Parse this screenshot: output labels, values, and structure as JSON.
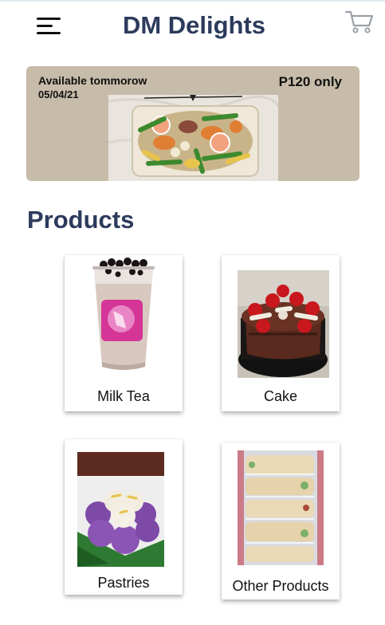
{
  "header": {
    "title": "DM Delights",
    "menu_icon": "hamburger-menu-icon",
    "cart_icon": "shopping-cart-icon"
  },
  "banner": {
    "availability": "Available tommorow",
    "date": "05/04/21",
    "price": "P120 only"
  },
  "products_section": {
    "title": "Products",
    "items": [
      {
        "label": "Milk Tea"
      },
      {
        "label": "Cake"
      },
      {
        "label": "Pastries"
      },
      {
        "label": "Other Products"
      }
    ]
  },
  "colors": {
    "title_text": "#2c3b5c",
    "banner_bg": "#c7bca9"
  }
}
